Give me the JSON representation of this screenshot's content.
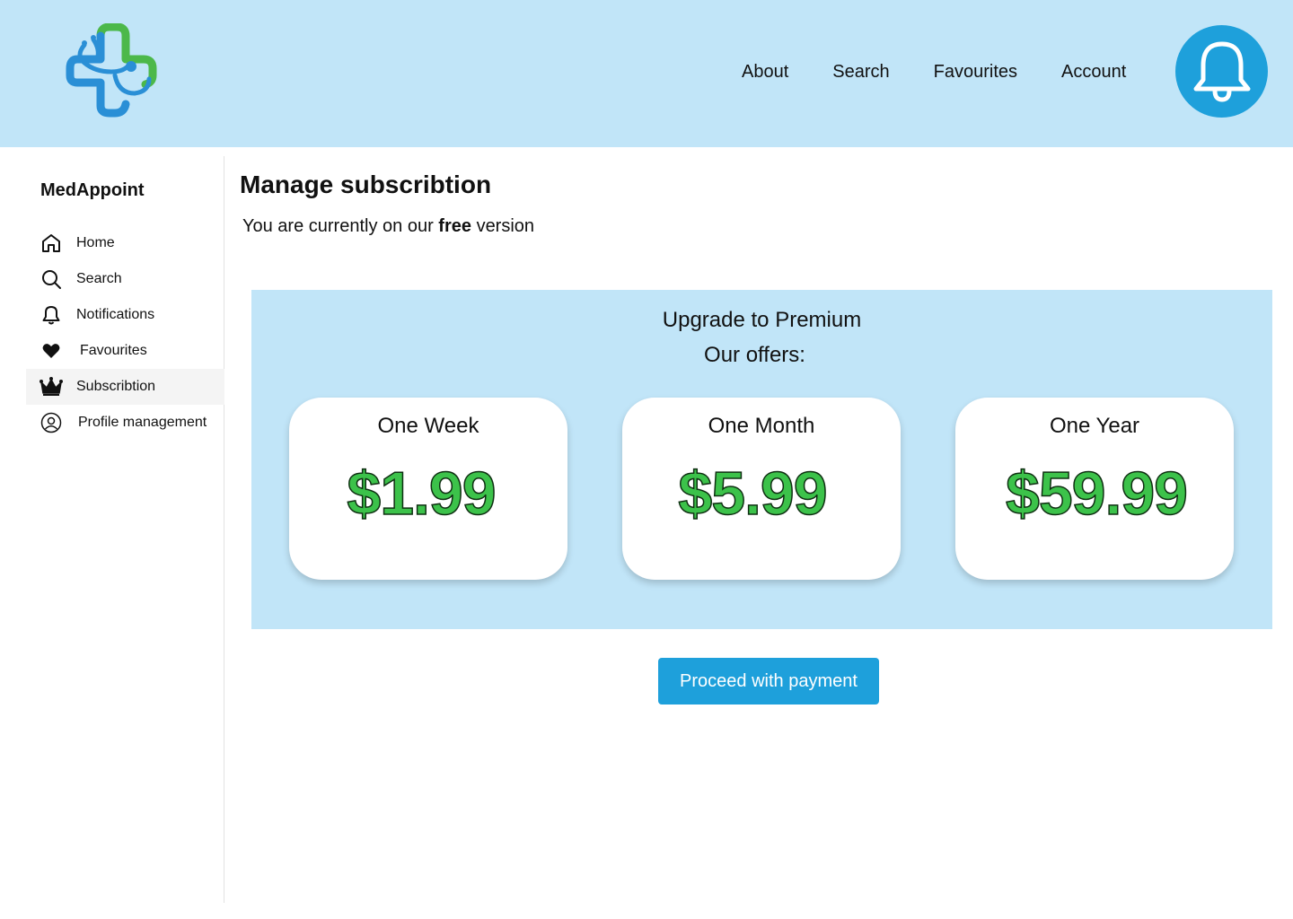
{
  "topnav": {
    "items": [
      {
        "label": "About"
      },
      {
        "label": "Search"
      },
      {
        "label": "Favourites"
      },
      {
        "label": "Account"
      }
    ],
    "notification_icon": "bell-icon"
  },
  "sidebar": {
    "brand": "MedAppoint",
    "active": "Subscribtion",
    "items": [
      {
        "label": "Home",
        "icon": "home-icon"
      },
      {
        "label": "Search",
        "icon": "search-icon"
      },
      {
        "label": "Notifications",
        "icon": "bell-icon"
      },
      {
        "label": "Favourites",
        "icon": "heart-icon"
      },
      {
        "label": "Subscribtion",
        "icon": "crown-icon"
      },
      {
        "label": "Profile management",
        "icon": "user-circle-icon"
      }
    ]
  },
  "main": {
    "title": "Manage subscribtion",
    "status_prefix": "You are currently on our",
    "status_plan": "free",
    "status_suffix": "version",
    "premium": {
      "heading": "Upgrade to Premium",
      "subheading": "Our offers:",
      "offers": [
        {
          "name": "One Week",
          "price": "$1.99"
        },
        {
          "name": "One Month",
          "price": "$5.99"
        },
        {
          "name": "One Year",
          "price": "$59.99"
        }
      ]
    },
    "pay_button": "Proceed with payment"
  },
  "colors": {
    "header_bg": "#c1e5f8",
    "accent": "#1ea0db",
    "price_green": "#3cc24a",
    "active_item_bg": "#f4f4f4"
  }
}
